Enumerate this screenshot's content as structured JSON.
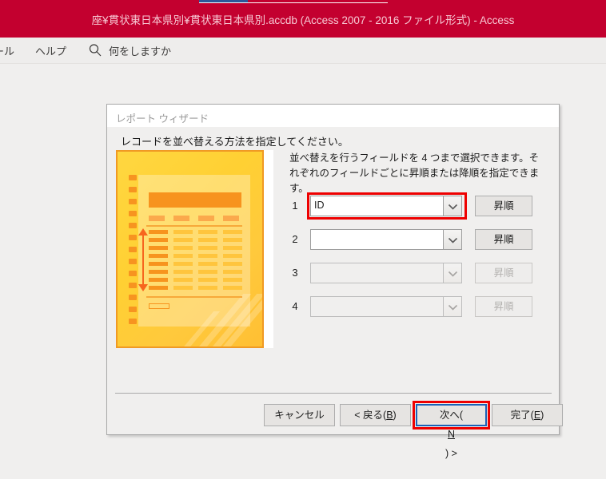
{
  "window": {
    "title": "座¥貫状東日本県別¥貫状東日本県別.accdb (Access 2007 - 2016 ファイル形式)  -  Access",
    "titlebar_color": "#c3002f",
    "accent_tab_color": "#2b579a"
  },
  "menubar": {
    "items": [
      {
        "label": "ール",
        "name": "menu-item-tools"
      },
      {
        "label": "ヘルプ",
        "name": "menu-item-help"
      }
    ],
    "search_icon": "search-icon",
    "tell_me": "何をしますか"
  },
  "dialog": {
    "title": "レポート ウィザード",
    "prompt": "レコードを並べ替える方法を指定してください。",
    "description": "並べ替えを行うフィールドを 4 つまで選択できます。それぞれのフィールドごとに昇順または降順を指定できます。",
    "preview_image_name": "report-sort-preview-illustration",
    "sort_rows": [
      {
        "number": "1",
        "value": "ID",
        "placeholder": "",
        "order_label": "昇順",
        "enabled": true,
        "highlighted": true
      },
      {
        "number": "2",
        "value": "",
        "placeholder": "",
        "order_label": "昇順",
        "enabled": true,
        "highlighted": false
      },
      {
        "number": "3",
        "value": "",
        "placeholder": "",
        "order_label": "昇順",
        "enabled": false,
        "highlighted": false
      },
      {
        "number": "4",
        "value": "",
        "placeholder": "",
        "order_label": "昇順",
        "enabled": false,
        "highlighted": false
      }
    ],
    "footer_buttons": {
      "cancel": "キャンセル",
      "back_prefix": "< 戻る(",
      "back_accel": "B",
      "back_suffix": ")",
      "next_prefix": "次へ(",
      "next_accel": "N",
      "next_suffix": ") >",
      "finish_prefix": "完了(",
      "finish_accel": "E",
      "finish_suffix": ")"
    },
    "annotation_color": "#ee0000",
    "focus_border_color": "#1a62b8"
  }
}
